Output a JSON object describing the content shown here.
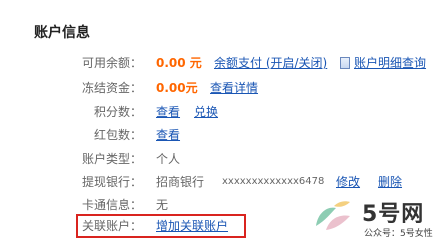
{
  "title": "账户信息",
  "available": {
    "label": "可用余额：",
    "amount": "0.00 元",
    "link1": "余额支付 (开启/关闭)",
    "link2": "账户明细查询"
  },
  "frozen": {
    "label": "冻结资金：",
    "amount": "0.00元",
    "link": "查看详情"
  },
  "points": {
    "label": "积分数：",
    "link1": "查看",
    "link2": "兑换"
  },
  "redpack": {
    "label": "红包数：",
    "link": "查看"
  },
  "account_type": {
    "label": "账户类型：",
    "value": "个人"
  },
  "withdraw_bank": {
    "label": "提现银行：",
    "bank": "招商银行",
    "number": "xxxxxxxxxxxxx6478",
    "edit": "修改",
    "delete": "删除"
  },
  "card": {
    "label": "卡通信息：",
    "value": "无"
  },
  "linked": {
    "label": "关联账户：",
    "link": "增加关联账户"
  },
  "watermark": {
    "brand": "5号网",
    "sub": "公众号：5号女性"
  },
  "colors": {
    "highlight": "#d9241f",
    "amount": "#ff6600",
    "link": "#1a56b4"
  }
}
